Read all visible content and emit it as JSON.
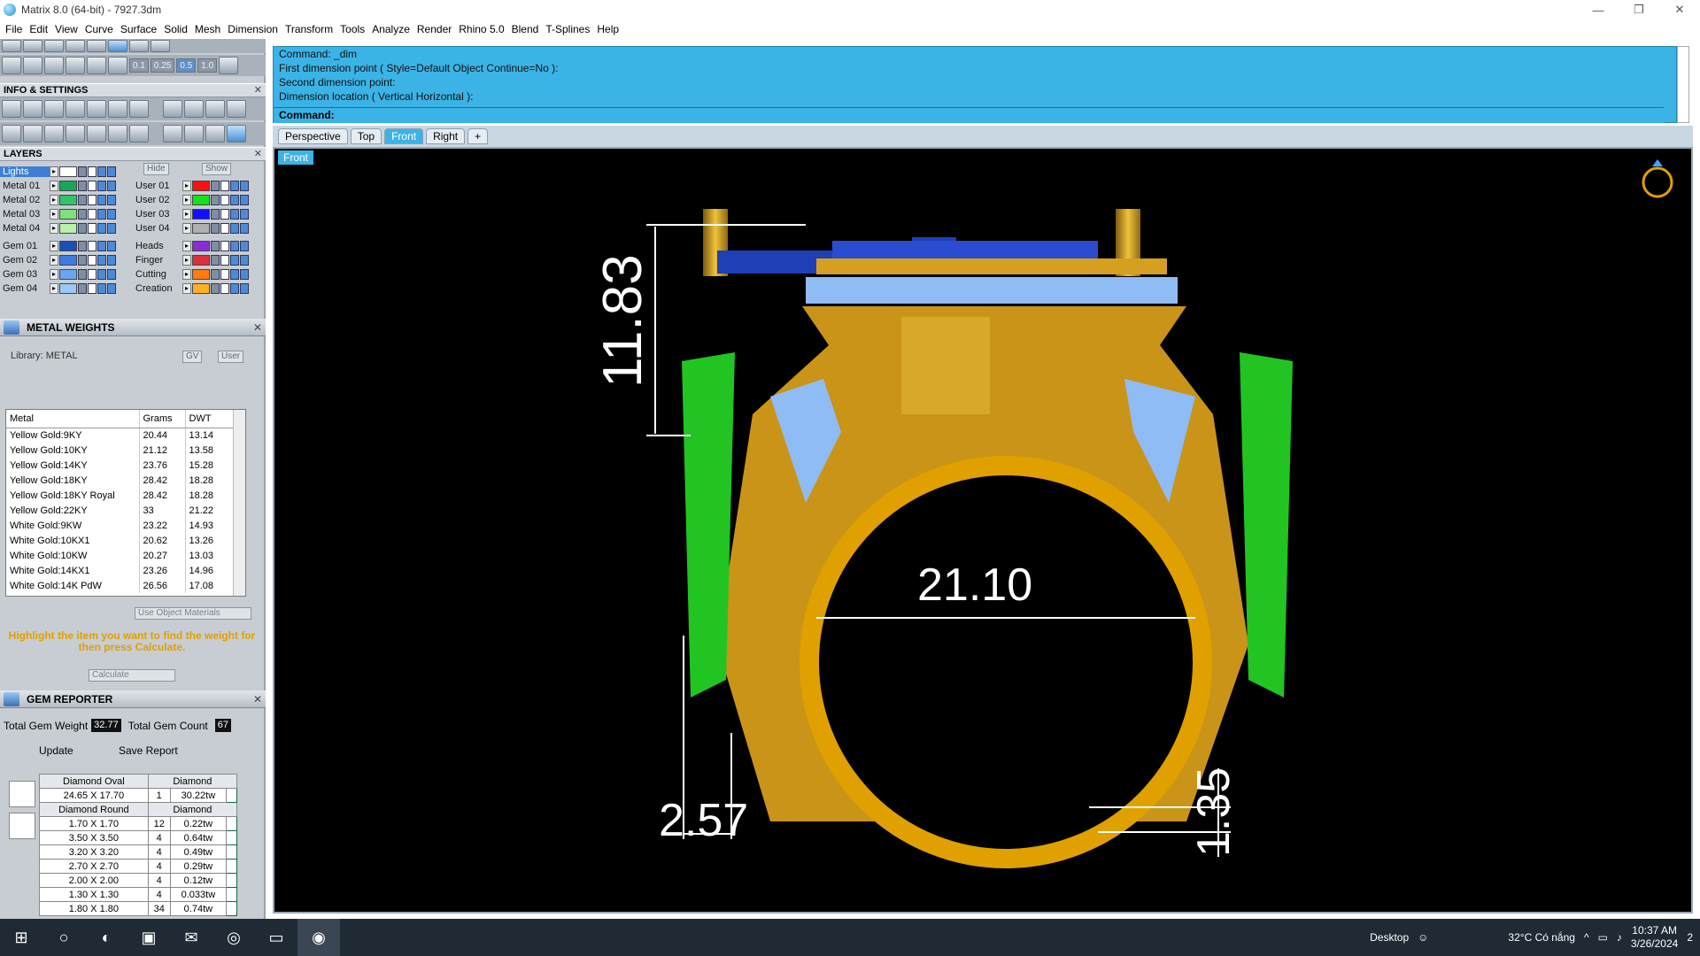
{
  "window": {
    "title": "Matrix 8.0 (64-bit) - 7927.3dm",
    "minimize": "—",
    "restore": "❐",
    "close": "✕"
  },
  "menu": [
    "File",
    "Edit",
    "View",
    "Curve",
    "Surface",
    "Solid",
    "Mesh",
    "Dimension",
    "Transform",
    "Tools",
    "Analyze",
    "Render",
    "Rhino 5.0",
    "Blend",
    "T-Splines",
    "Help"
  ],
  "snap_values": [
    "0.1",
    "0.25",
    "0.5",
    "1.0"
  ],
  "info_settings": {
    "title": "INFO & SETTINGS"
  },
  "layers": {
    "title": "LAYERS",
    "hide_label": "Hide",
    "show_label": "Show",
    "left": [
      {
        "name": "Lights",
        "color": "#ffffff"
      },
      {
        "name": "Metal 01",
        "color": "#19a55a"
      },
      {
        "name": "Metal 02",
        "color": "#31c46b"
      },
      {
        "name": "Metal 03",
        "color": "#7fe07f"
      },
      {
        "name": "Metal 04",
        "color": "#b9f0b0"
      },
      {
        "name": "Gem 01",
        "color": "#1c4fb5"
      },
      {
        "name": "Gem 02",
        "color": "#3c7be0"
      },
      {
        "name": "Gem 03",
        "color": "#6aa6f0"
      },
      {
        "name": "Gem 04",
        "color": "#9cc8f5"
      }
    ],
    "right": [
      {
        "name": "User 01",
        "color": "#ff1010"
      },
      {
        "name": "User 02",
        "color": "#18e018"
      },
      {
        "name": "User 03",
        "color": "#1010ff"
      },
      {
        "name": "User 04",
        "color": "#b0b0b0"
      },
      {
        "name": "Heads",
        "color": "#8a2bd8"
      },
      {
        "name": "Finger",
        "color": "#d83040"
      },
      {
        "name": "Cutting",
        "color": "#ff7a10"
      },
      {
        "name": "Creation",
        "color": "#ffb020"
      }
    ]
  },
  "metal_weights": {
    "title": "METAL WEIGHTS",
    "library": "Library: METAL",
    "gv": "GV",
    "user": "User",
    "columns": [
      "Metal",
      "Grams",
      "DWT"
    ],
    "rows": [
      [
        "Yellow Gold:9KY",
        "20.44",
        "13.14"
      ],
      [
        "Yellow Gold:10KY",
        "21.12",
        "13.58"
      ],
      [
        "Yellow Gold:14KY",
        "23.76",
        "15.28"
      ],
      [
        "Yellow Gold:18KY",
        "28.42",
        "18.28"
      ],
      [
        "Yellow Gold:18KY Royal",
        "28.42",
        "18.28"
      ],
      [
        "Yellow Gold:22KY",
        "33",
        "21.22"
      ],
      [
        "White Gold:9KW",
        "23.22",
        "14.93"
      ],
      [
        "White Gold:10KX1",
        "20.62",
        "13.26"
      ],
      [
        "White Gold:10KW",
        "20.27",
        "13.03"
      ],
      [
        "White Gold:14KX1",
        "23.26",
        "14.96"
      ],
      [
        "White Gold:14K PdW",
        "26.56",
        "17.08"
      ]
    ],
    "use_object_materials": "Use Object Materials",
    "hint": "Highlight the item you want to find the weight for then press Calculate.",
    "calculate": "Calculate"
  },
  "gem_reporter": {
    "title": "GEM REPORTER",
    "total_weight_label": "Total Gem Weight",
    "total_weight": "32.77",
    "total_count_label": "Total Gem Count",
    "total_count": "67",
    "update": "Update",
    "save_report": "Save Report",
    "groups": [
      {
        "shape": "Diamond Oval",
        "material": "Diamond",
        "rows": [
          [
            "24.65 X 17.70",
            "1",
            "30.22tw"
          ]
        ]
      },
      {
        "shape": "Diamond Round",
        "material": "Diamond",
        "rows": [
          [
            "1.70 X 1.70",
            "12",
            "0.22tw"
          ],
          [
            "3.50 X 3.50",
            "4",
            "0.64tw"
          ],
          [
            "3.20 X 3.20",
            "4",
            "0.49tw"
          ],
          [
            "2.70 X 2.70",
            "4",
            "0.29tw"
          ],
          [
            "2.00 X 2.00",
            "4",
            "0.12tw"
          ],
          [
            "1.30 X 1.30",
            "4",
            "0.033tw"
          ],
          [
            "1.80 X 1.80",
            "34",
            "0.74tw"
          ]
        ]
      }
    ]
  },
  "command": {
    "lines": [
      "Command: _dim",
      "First dimension point ( Style=Default  Object  Continue=No ):",
      "Second dimension point:",
      "Dimension location ( Vertical  Horizontal ):"
    ],
    "prompt": "Command:"
  },
  "tabs": [
    "Perspective",
    "Top",
    "Front",
    "Right"
  ],
  "active_tab": "Front",
  "viewport": {
    "label": "Front",
    "dims": {
      "height": "11.83",
      "width": "21.10",
      "shank": "2.57",
      "thickness": "1.35"
    }
  },
  "taskbar": {
    "desktop": "Desktop",
    "weather": "32°C  Có nắng",
    "time": "10:37 AM",
    "date": "3/26/2024",
    "notif": "2"
  }
}
